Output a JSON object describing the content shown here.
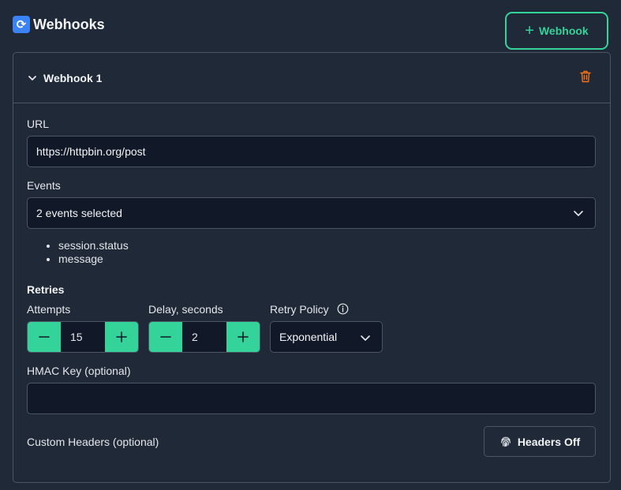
{
  "header": {
    "title": "Webhooks",
    "title_icon": "refresh-arrows-icon",
    "add_button_label": "Webhook"
  },
  "webhook": {
    "name": "Webhook 1",
    "url_label": "URL",
    "url_value": "https://httpbin.org/post",
    "events_label": "Events",
    "events_value": "2 events selected",
    "events": [
      "session.status",
      "message"
    ],
    "retries": {
      "title": "Retries",
      "attempts_label": "Attempts",
      "attempts_value": "15",
      "delay_label": "Delay, seconds",
      "delay_value": "2",
      "policy_label": "Retry Policy",
      "policy_value": "Exponential"
    },
    "hmac_label": "HMAC Key (optional)",
    "hmac_value": "",
    "custom_headers_label": "Custom Headers (optional)",
    "headers_button_label": "Headers Off"
  },
  "colors": {
    "accent": "#34d399",
    "danger": "#f97316",
    "background": "#1f2937",
    "input": "#111827",
    "border": "#4b5563"
  }
}
